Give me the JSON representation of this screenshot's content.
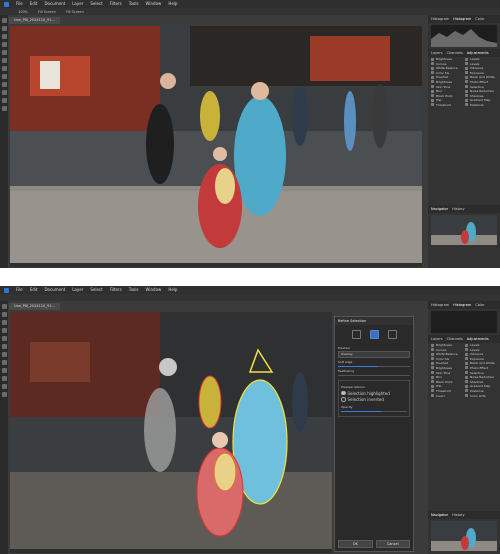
{
  "menu": [
    "File",
    "Edit",
    "Document",
    "Layer",
    "Select",
    "Filters",
    "Tools",
    "Window",
    "Help"
  ],
  "context_tabs": [
    "100%",
    "Fill Screen",
    "Fill Screen"
  ],
  "document": {
    "tab_label": "Uae_P8i_2024110_91..."
  },
  "right_panel": {
    "top_tabs": [
      "Histogram",
      "Histogram",
      "Color"
    ],
    "mid_tabs": [
      "Layers",
      "Channels",
      "Adjustments"
    ],
    "nav_tabs": [
      "Navigator",
      "History"
    ],
    "adjustments_left": [
      "Brightness",
      "Curves",
      "White Balance",
      "Color SG",
      "Hue/Sat",
      "Brightness",
      "Skin Tone",
      "Blur",
      "Black Point",
      "HSL",
      "Threshold",
      "Invert"
    ],
    "adjustments_right": [
      "Levels",
      "Levels",
      "Vibrance",
      "Exposure",
      "Black And White",
      "Photo Effect",
      "Selective",
      "Noise Reduction",
      "Shadows",
      "Gradient Map",
      "Posterize",
      "Color LUTs"
    ]
  },
  "dialog": {
    "title": "Refine Selection",
    "mode_label": "Preview",
    "mode_value": "Overlay",
    "slider1_label": "Soft edge",
    "slider2_label": "Feathering",
    "options_label": "Preview options",
    "option1": "Selection highlighted",
    "option2": "Selection inverted",
    "opacity_label": "Opacity",
    "ok_label": "OK",
    "cancel_label": "Cancel",
    "slider_values": [
      0.55,
      0.0,
      0.6
    ]
  },
  "colors": {
    "sky_shadow": "#3a3d40",
    "shrine_red": "#b8452e",
    "gravel": "#8f8b84",
    "blue_robe": "#4fa9c9",
    "red_kimono": "#c23a3a",
    "dark_coat": "#1f1f1f",
    "selection_yellow": "#f4e03a",
    "selection_red": "#e03232"
  }
}
